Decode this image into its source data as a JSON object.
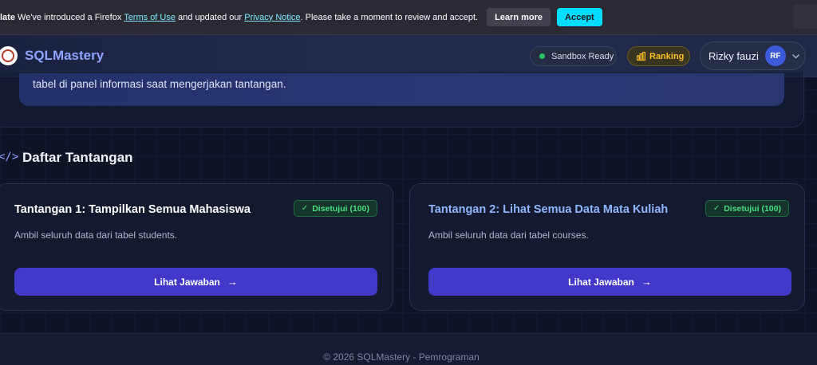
{
  "notification": {
    "lead": "late",
    "text_1": " We've introduced a Firefox ",
    "terms_link": "Terms of Use",
    "text_2": " and updated our ",
    "privacy_link": "Privacy Notice",
    "text_3": ". Please take a moment to review and accept.",
    "learn_more": "Learn more",
    "accept": "Accept"
  },
  "header": {
    "brand": "SQLMastery",
    "sandbox_status": "Sandbox Ready",
    "ranking_label": "Ranking",
    "user_name": "Rizky fauzi",
    "avatar_initials": "RF"
  },
  "info": {
    "text": "tabel di panel informasi saat mengerjakan tantangan."
  },
  "section": {
    "icon": "</>",
    "title": "Daftar Tantangan"
  },
  "challenges": [
    {
      "title": "Tantangan 1: Tampilkan Semua Mahasiswa",
      "badge": "Disetujui (100)",
      "description": "Ambil seluruh data dari tabel students.",
      "button": "Lihat Jawaban"
    },
    {
      "title": "Tantangan 2: Lihat Semua Data Mata Kuliah",
      "badge": "Disetujui (100)",
      "description": "Ambil seluruh data dari tabel courses.",
      "button": "Lihat Jawaban"
    }
  ],
  "footer": {
    "text": "© 2026 SQLMastery - Pemrograman"
  },
  "colors": {
    "accent": "#4338ca",
    "brand": "#8fa3ff",
    "success": "#4ade80",
    "ranking": "#fbbf24"
  }
}
